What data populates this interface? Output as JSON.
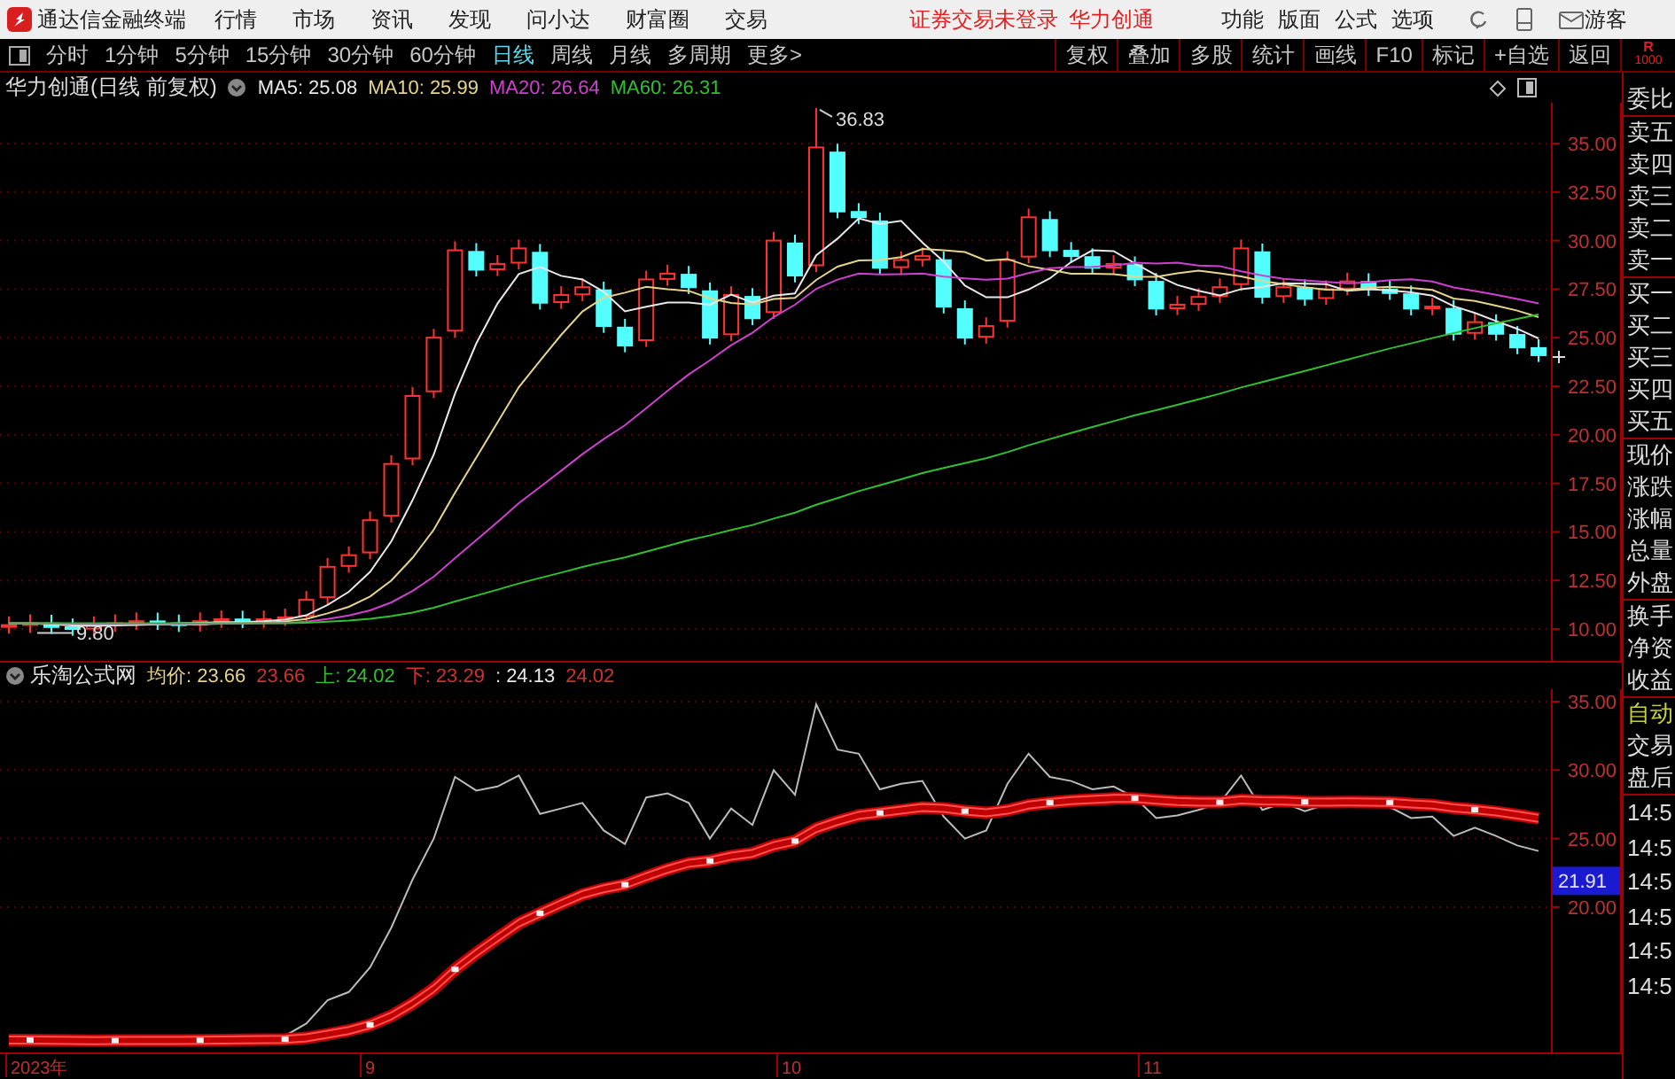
{
  "menubar": {
    "app_title": "通达信金融终端",
    "menus": [
      "行情",
      "市场",
      "资讯",
      "发现",
      "问小达",
      "财富圈",
      "交易"
    ],
    "notice": "证券交易未登录",
    "stock_link": "华力创通",
    "tools": [
      "功能",
      "版面",
      "公式",
      "选项"
    ],
    "user": "游客"
  },
  "toolbar": {
    "periods": [
      {
        "label": "分时",
        "selected": false
      },
      {
        "label": "1分钟",
        "selected": false
      },
      {
        "label": "5分钟",
        "selected": false
      },
      {
        "label": "15分钟",
        "selected": false
      },
      {
        "label": "30分钟",
        "selected": false
      },
      {
        "label": "60分钟",
        "selected": false
      },
      {
        "label": "日线",
        "selected": true
      },
      {
        "label": "周线",
        "selected": false
      },
      {
        "label": "月线",
        "selected": false
      },
      {
        "label": "多周期",
        "selected": false
      },
      {
        "label": "更多>",
        "selected": false
      }
    ],
    "buttons": [
      "复权",
      "叠加",
      "多股",
      "统计",
      "画线",
      "F10",
      "标记",
      "+自选",
      "返回"
    ],
    "corner": [
      "R",
      "1000"
    ]
  },
  "main_chart": {
    "title": "华力创通(日线 前复权)",
    "ma": [
      {
        "label": "MA5: 25.08",
        "color": "#e8e8e8"
      },
      {
        "label": "MA10: 25.99",
        "color": "#e6d48c"
      },
      {
        "label": "MA20: 26.64",
        "color": "#d040d0"
      },
      {
        "label": "MA60: 26.31",
        "color": "#30c030"
      }
    ],
    "high_label": "36.83",
    "low_label": "9.80",
    "price_axis": [
      "35.00",
      "32.50",
      "30.00",
      "27.50",
      "25.00",
      "22.50",
      "20.00",
      "17.50",
      "15.00",
      "12.50",
      "10.00"
    ]
  },
  "indicator": {
    "name": "乐淘公式网",
    "values": [
      {
        "label": "均价: 23.66",
        "color": "#e6d48c"
      },
      {
        "label": "23.66",
        "color": "#d03030"
      },
      {
        "label": "上: 24.02",
        "color": "#30c030"
      },
      {
        "label": "下: 23.29",
        "color": "#d03030"
      },
      {
        "label": ": 24.13",
        "color": "#e8e8e8"
      },
      {
        "label": "24.02",
        "color": "#d03030"
      }
    ],
    "axis": [
      "35.00",
      "30.00",
      "25.00",
      "20.00"
    ],
    "current_value": "21.91"
  },
  "date_axis": [
    "2023年",
    "9",
    "10",
    "11"
  ],
  "quote_panel": {
    "labels": [
      "委比",
      "卖五",
      "卖四",
      "卖三",
      "卖二",
      "卖一",
      "买一",
      "买二",
      "买三",
      "买四",
      "买五",
      "现价",
      "涨跌",
      "涨幅",
      "总量",
      "外盘",
      "换手",
      "净资",
      "收益"
    ],
    "mode": "自动",
    "sections": [
      "交易",
      "盘后"
    ],
    "times": [
      "14:5",
      "14:5",
      "14:5",
      "14:5",
      "14:5",
      "14:5"
    ]
  }
}
